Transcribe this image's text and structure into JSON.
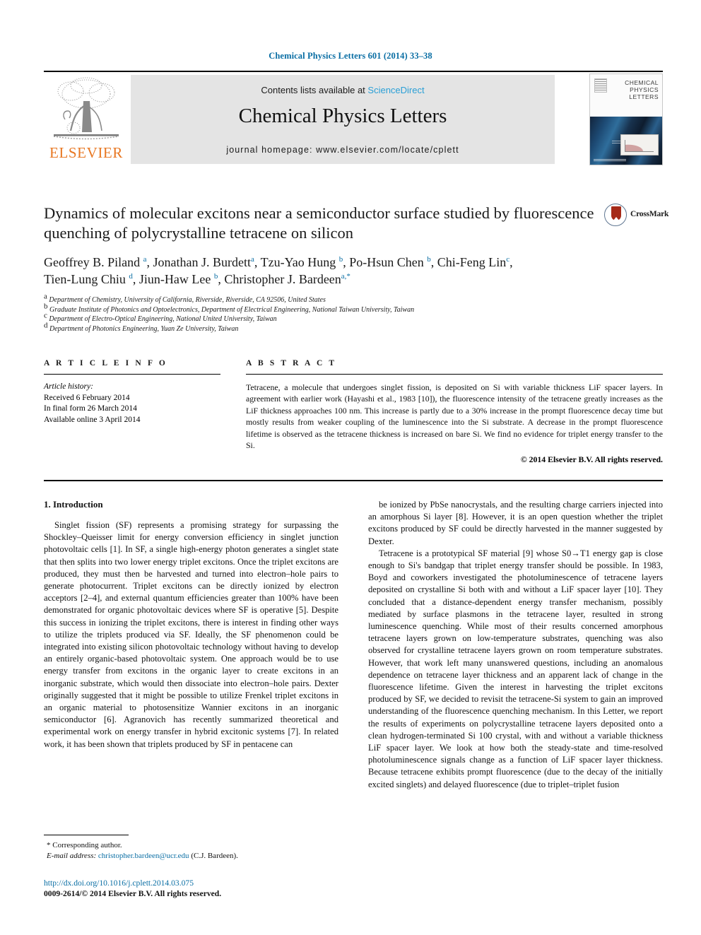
{
  "running_head": "Chemical Physics Letters 601 (2014) 33–38",
  "masthead": {
    "contents_prefix": "Contents lists available at ",
    "sciencedirect": "ScienceDirect",
    "journal_title": "Chemical Physics Letters",
    "homepage": "journal homepage: www.elsevier.com/locate/cplett",
    "publisher_name": "ELSEVIER",
    "cover_title_line1": "CHEMICAL",
    "cover_title_line2": "PHYSICS",
    "cover_title_line3": "LETTERS"
  },
  "article": {
    "title": "Dynamics of molecular excitons near a semiconductor surface studied by fluorescence quenching of polycrystalline tetracene on silicon",
    "crossmark_label": "CrossMark",
    "authors_line1": "Geoffrey B. Piland a, Jonathan J. Burdett a, Tzu-Yao Hung b, Po-Hsun Chen b, Chi-Feng Lin c,",
    "authors_line2": "Tien-Lung Chiu d, Jiun-Haw Lee b, Christopher J. Bardeen a,*",
    "affiliations": [
      "a Department of Chemistry, University of California, Riverside, Riverside, CA 92506, United States",
      "b Graduate Institute of Photonics and Optoelectronics, Department of Electrical Engineering, National Taiwan University, Taiwan",
      "c Department of Electro-Optical Engineering, National United University, Taiwan",
      "d Department of Photonics Engineering, Yuan Ze University, Taiwan"
    ]
  },
  "info": {
    "heading": "A R T I C L E    I N F O",
    "history_label": "Article history:",
    "history": [
      "Received 6 February 2014",
      "In final form 26 March 2014",
      "Available online 3 April 2014"
    ]
  },
  "abstract": {
    "heading": "A B S T R A C T",
    "text": "Tetracene, a molecule that undergoes singlet fission, is deposited on Si with variable thickness LiF spacer layers. In agreement with earlier work (Hayashi et al., 1983 [10]), the fluorescence intensity of the tetracene greatly increases as the LiF thickness approaches 100 nm. This increase is partly due to a 30% increase in the prompt fluorescence decay time but mostly results from weaker coupling of the luminescence into the Si substrate. A decrease in the prompt fluorescence lifetime is observed as the tetracene thickness is increased on bare Si. We find no evidence for triplet energy transfer to the Si.",
    "copyright": "© 2014 Elsevier B.V. All rights reserved."
  },
  "body": {
    "section_title": "1. Introduction",
    "left_paragraph": "Singlet fission (SF) represents a promising strategy for surpassing the Shockley–Queisser limit for energy conversion efficiency in singlet junction photovoltaic cells [1]. In SF, a single high-energy photon generates a singlet state that then splits into two lower energy triplet excitons. Once the triplet excitons are produced, they must then be harvested and turned into electron–hole pairs to generate photocurrent. Triplet excitons can be directly ionized by electron acceptors [2–4], and external quantum efficiencies greater than 100% have been demonstrated for organic photovoltaic devices where SF is operative [5]. Despite this success in ionizing the triplet excitons, there is interest in finding other ways to utilize the triplets produced via SF. Ideally, the SF phenomenon could be integrated into existing silicon photovoltaic technology without having to develop an entirely organic-based photovoltaic system. One approach would be to use energy transfer from excitons in the organic layer to create excitons in an inorganic substrate, which would then dissociate into electron–hole pairs. Dexter originally suggested that it might be possible to utilize Frenkel triplet excitons in an organic material to photosensitize Wannier excitons in an inorganic semiconductor [6]. Agranovich has recently summarized theoretical and experimental work on energy transfer in hybrid excitonic systems [7]. In related work, it has been shown that triplets produced by SF in pentacene can",
    "right_paragraph_1": "be ionized by PbSe nanocrystals, and the resulting charge carriers injected into an amorphous Si layer [8]. However, it is an open question whether the triplet excitons produced by SF could be directly harvested in the manner suggested by Dexter.",
    "right_paragraph_2": "Tetracene is a prototypical SF material [9] whose S0→T1 energy gap is close enough to Si's bandgap that triplet energy transfer should be possible. In 1983, Boyd and coworkers investigated the photoluminescence of tetracene layers deposited on crystalline Si both with and without a LiF spacer layer [10]. They concluded that a distance-dependent energy transfer mechanism, possibly mediated by surface plasmons in the tetracene layer, resulted in strong luminescence quenching. While most of their results concerned amorphous tetracene layers grown on low-temperature substrates, quenching was also observed for crystalline tetracene layers grown on room temperature substrates. However, that work left many unanswered questions, including an anomalous dependence on tetracene layer thickness and an apparent lack of change in the fluorescence lifetime. Given the interest in harvesting the triplet excitons produced by SF, we decided to revisit the tetracene-Si system to gain an improved understanding of the fluorescence quenching mechanism. In this Letter, we report the results of experiments on polycrystalline tetracene layers deposited onto a clean hydrogen-terminated Si 100 crystal, with and without a variable thickness LiF spacer layer. We look at how both the steady-state and time-resolved photoluminescence signals change as a function of LiF spacer layer thickness. Because tetracene exhibits prompt fluorescence (due to the decay of the initially excited singlets) and delayed fluorescence (due to triplet–triplet fusion"
  },
  "footnote": {
    "corresponding": "* Corresponding author.",
    "email_label": "E-mail address:",
    "email": "christopher.bardeen@ucr.edu",
    "email_suffix": "(C.J. Bardeen)."
  },
  "footer": {
    "doi": "http://dx.doi.org/10.1016/j.cplett.2014.03.075",
    "issn_line": "0009-2614/© 2014 Elsevier B.V. All rights reserved."
  },
  "colors": {
    "link": "#0a6ea4",
    "sciencedirect": "#2a9fd6",
    "elsevier_orange": "#E87722",
    "band_grey": "#e4e4e4"
  }
}
